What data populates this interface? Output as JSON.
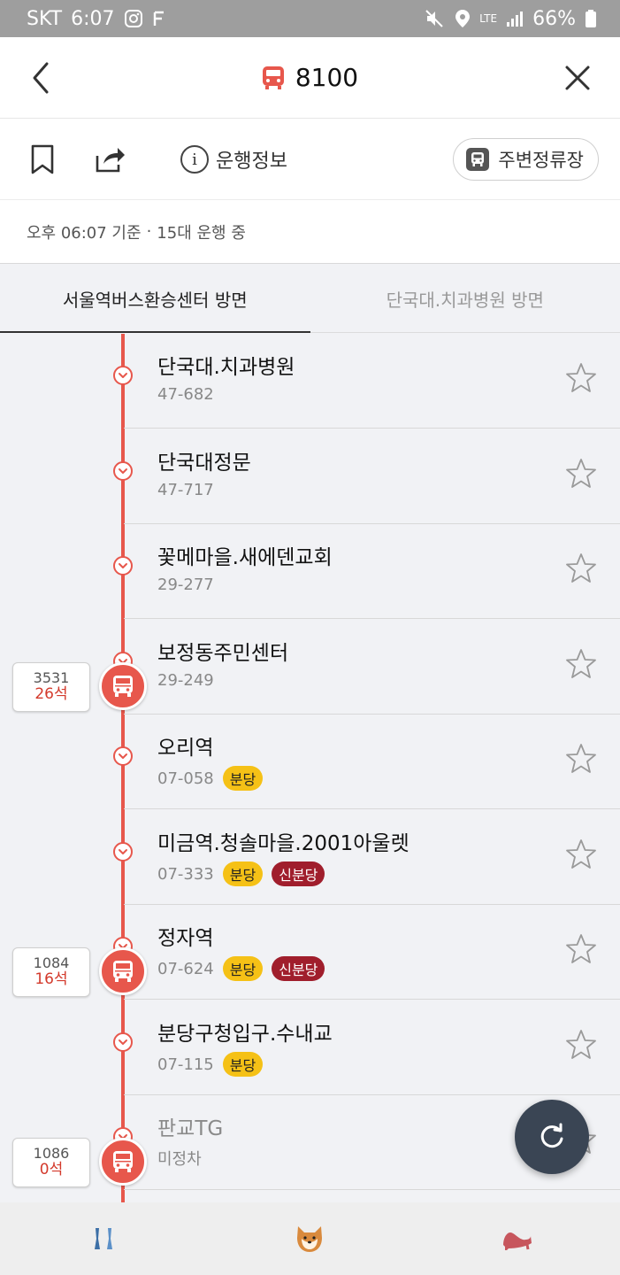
{
  "status_bar": {
    "carrier": "SKT",
    "time": "6:07",
    "network": "LTE",
    "battery": "66%"
  },
  "header": {
    "route_number": "8100",
    "accent_color": "#e7574c"
  },
  "toolbar": {
    "info_label": "운행정보",
    "nearby_label": "주변정류장"
  },
  "summary": {
    "time_basis": "오후 06:07 기준",
    "separator": "·",
    "running": "15대 운행 중"
  },
  "tabs": [
    {
      "label": "서울역버스환승센터 방면",
      "active": true
    },
    {
      "label": "단국대.치과병원 방면",
      "active": false
    }
  ],
  "stops": [
    {
      "name": "단국대.치과병원",
      "number": "47-682",
      "badges": []
    },
    {
      "name": "단국대정문",
      "number": "47-717",
      "badges": []
    },
    {
      "name": "꽃메마을.새에덴교회",
      "number": "29-277",
      "badges": []
    },
    {
      "name": "보정동주민센터",
      "number": "29-249",
      "badges": []
    },
    {
      "name": "오리역",
      "number": "07-058",
      "badges": [
        "분당"
      ]
    },
    {
      "name": "미금역.청솔마을.2001아울렛",
      "number": "07-333",
      "badges": [
        "분당",
        "신분당"
      ]
    },
    {
      "name": "정자역",
      "number": "07-624",
      "badges": [
        "분당",
        "신분당"
      ]
    },
    {
      "name": "분당구청입구.수내교",
      "number": "07-115",
      "badges": [
        "분당"
      ]
    },
    {
      "name": "판교TG",
      "number": "미정차",
      "badges": []
    }
  ],
  "buses": [
    {
      "vehicle": "3531",
      "seats": "26석"
    },
    {
      "vehicle": "1084",
      "seats": "16석"
    },
    {
      "vehicle": "1086",
      "seats": "0석"
    }
  ]
}
